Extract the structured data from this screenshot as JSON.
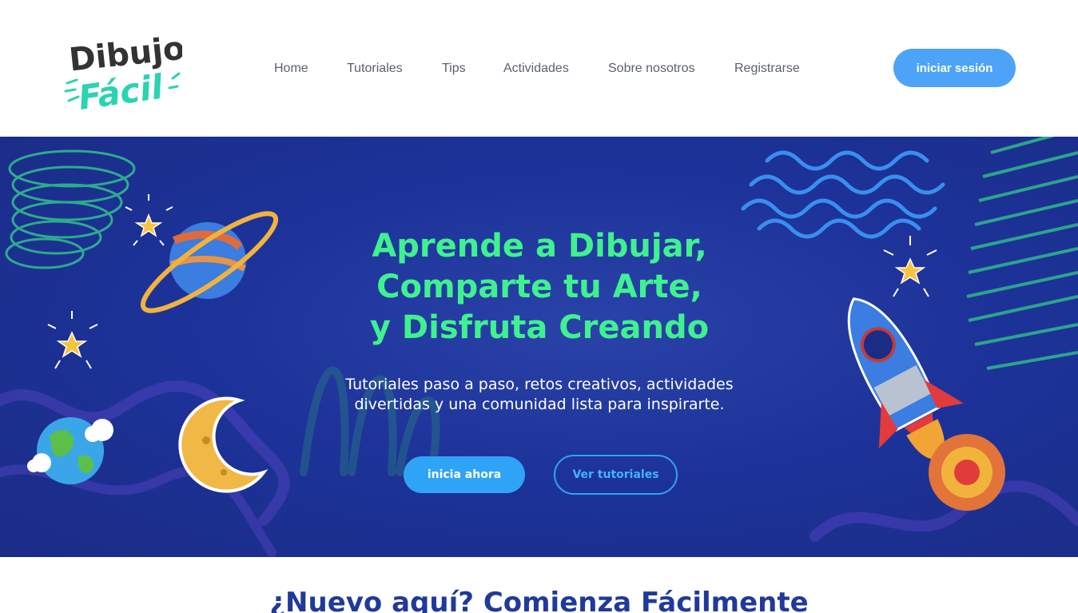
{
  "header": {
    "logo_line1": "Dibujo",
    "logo_line2": "Fácil",
    "nav": [
      {
        "label": "Home"
      },
      {
        "label": "Tutoriales"
      },
      {
        "label": "Tips"
      },
      {
        "label": "Actividades"
      },
      {
        "label": "Sobre nosotros"
      },
      {
        "label": "Registrarse"
      }
    ],
    "login_label": "iniciar sesión"
  },
  "hero": {
    "title_lines": [
      "Aprende a Dibujar,",
      "Comparte tu Arte,",
      "y Disfruta Creando"
    ],
    "subtitle_lines": [
      "Tutoriales paso a paso, retos creativos, actividades",
      "divertidas y una comunidad lista para inspirarte."
    ],
    "primary_button": "inicia ahora",
    "secondary_button": "Ver tutoriales",
    "illustrations": [
      "planet-icon",
      "star-icon",
      "moon-icon",
      "earth-icon",
      "rocket-icon"
    ]
  },
  "section": {
    "title": "¿Nuevo aquí? Comienza Fácilmente"
  },
  "colors": {
    "accent_blue": "#4da3f7",
    "hero_bg": "#1d339a",
    "hero_title": "#3ff28f",
    "section_title": "#1f3a9a",
    "nav_text": "#5a6070"
  }
}
